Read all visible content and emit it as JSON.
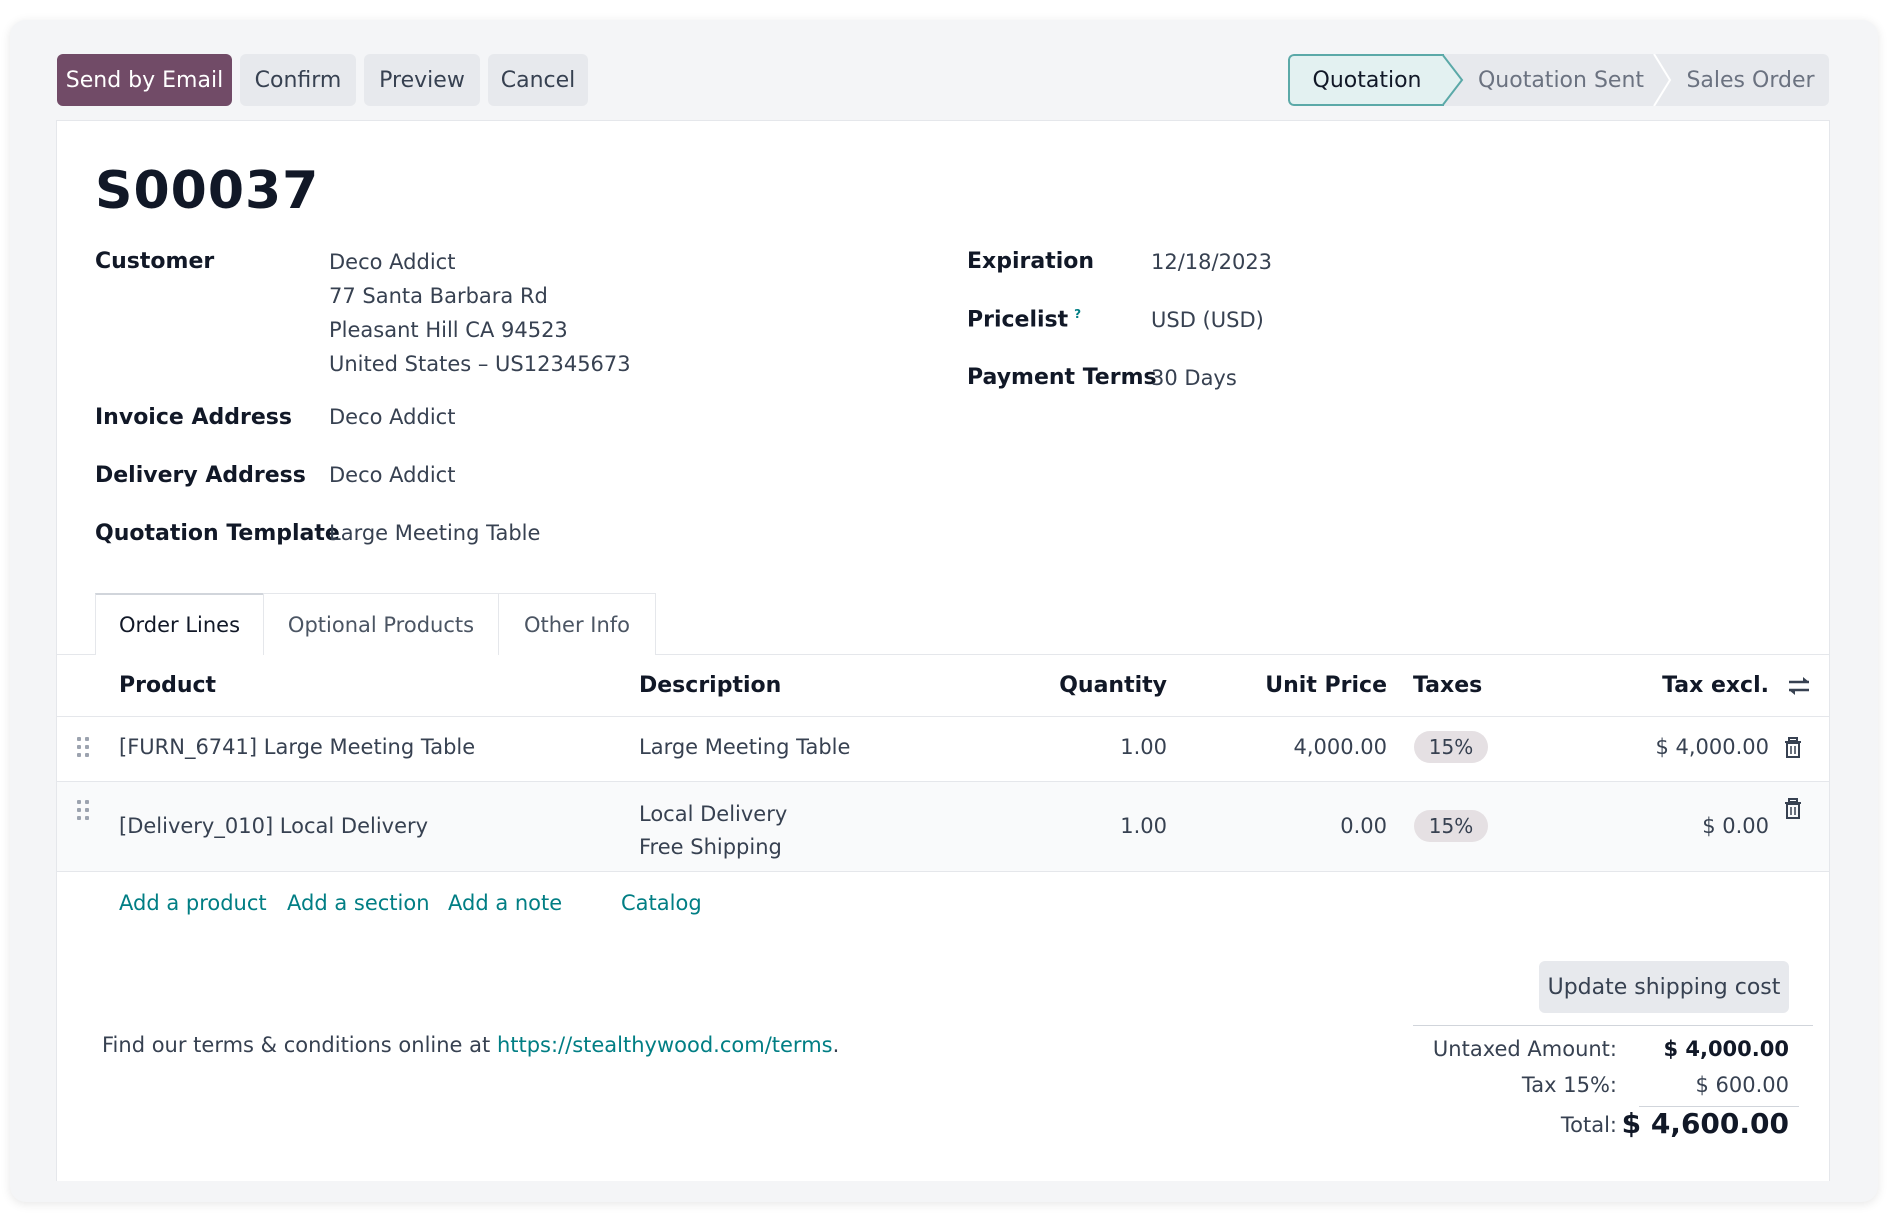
{
  "toolbar": {
    "send_by_email": "Send by Email",
    "confirm": "Confirm",
    "preview": "Preview",
    "cancel": "Cancel"
  },
  "statusbar": {
    "stages": [
      "Quotation",
      "Quotation Sent",
      "Sales Order"
    ],
    "active": "Quotation"
  },
  "record": {
    "name": "S00037"
  },
  "fields": {
    "customer_label": "Customer",
    "customer_name": "Deco Addict",
    "customer_addr1": "77 Santa Barbara Rd",
    "customer_addr2": "Pleasant Hill CA 94523",
    "customer_addr3": "United States – US12345673",
    "invoice_label": "Invoice Address",
    "invoice_value": "Deco Addict",
    "delivery_label": "Delivery Address",
    "delivery_value": "Deco Addict",
    "template_label": "Quotation Template",
    "template_value": "Large Meeting Table",
    "expiration_label": "Expiration",
    "expiration_value": "12/18/2023",
    "pricelist_label": "Pricelist",
    "pricelist_help": "?",
    "pricelist_value": "USD (USD)",
    "payment_terms_label": "Payment Terms",
    "payment_terms_value": "30 Days"
  },
  "tabs": [
    "Order Lines",
    "Optional Products",
    "Other Info"
  ],
  "table": {
    "columns": {
      "product": "Product",
      "description": "Description",
      "quantity": "Quantity",
      "unit_price": "Unit Price",
      "taxes": "Taxes",
      "tax_excl": "Tax excl."
    },
    "rows": [
      {
        "product": "[FURN_6741] Large Meeting Table",
        "description1": "Large Meeting Table",
        "description2": "",
        "quantity": "1.00",
        "unit_price": "4,000.00",
        "tax": "15%",
        "subtotal": "$ 4,000.00"
      },
      {
        "product": "[Delivery_010] Local Delivery",
        "description1": "Local Delivery",
        "description2": "Free Shipping",
        "quantity": "1.00",
        "unit_price": "0.00",
        "tax": "15%",
        "subtotal": "$ 0.00"
      }
    ],
    "actions": {
      "add_product": "Add a product",
      "add_section": "Add a section",
      "add_note": "Add a note",
      "catalog": "Catalog"
    }
  },
  "terms": {
    "text": "Find our terms & conditions online at ",
    "url": "https://stealthywood.com/terms",
    "suffix": "."
  },
  "update_shipping": "Update shipping cost",
  "totals": {
    "untaxed_label": "Untaxed Amount:",
    "untaxed_value": "$ 4,000.00",
    "tax_label": "Tax 15%:",
    "tax_value": "$ 600.00",
    "total_label": "Total:",
    "total_value": "$ 4,600.00"
  },
  "colors": {
    "primary": "#714b67",
    "link": "#017e84",
    "active_stage_bg": "#e3f1f1"
  }
}
